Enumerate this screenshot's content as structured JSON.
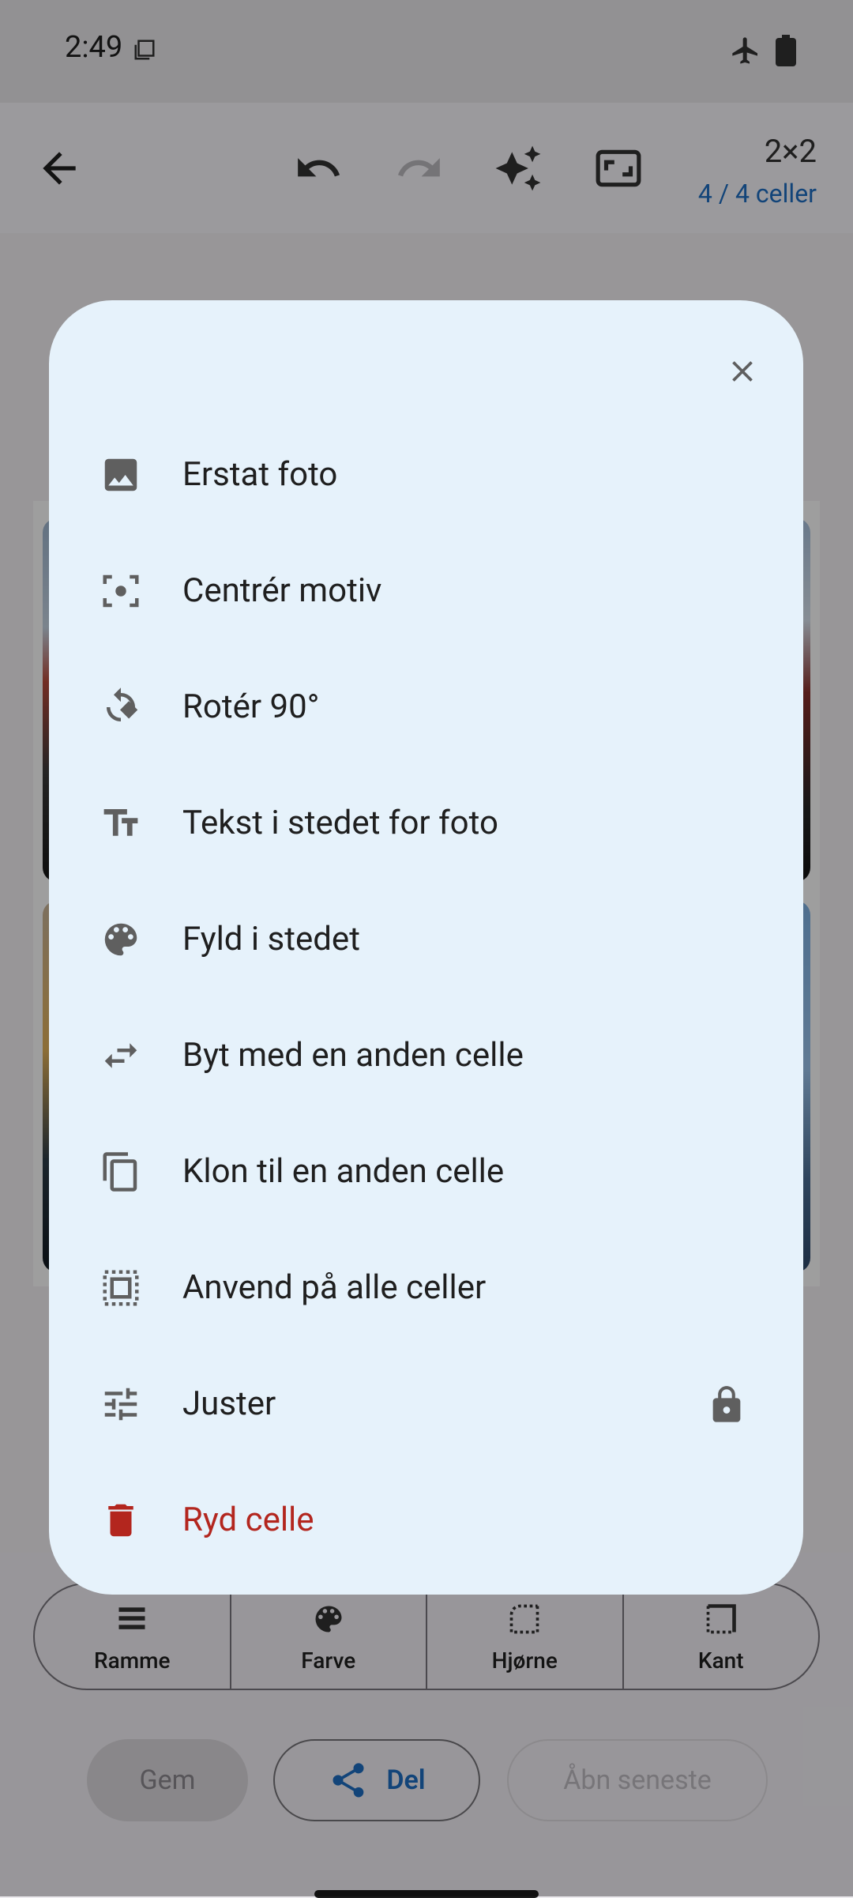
{
  "status_bar": {
    "time": "2:49"
  },
  "app_bar": {
    "grid_size": "2×2",
    "cell_count": "4 / 4 celler"
  },
  "toolbar": [
    {
      "label": "Ramme",
      "icon": "frame-icon"
    },
    {
      "label": "Farve",
      "icon": "palette-icon"
    },
    {
      "label": "Hjørne",
      "icon": "corner-icon"
    },
    {
      "label": "Kant",
      "icon": "border-icon"
    }
  ],
  "actions": {
    "save": "Gem",
    "share": "Del",
    "open_recent": "Åbn seneste"
  },
  "menu": {
    "items": [
      {
        "label": "Erstat foto",
        "icon": "image-icon"
      },
      {
        "label": "Centrér motiv",
        "icon": "center-focus-icon"
      },
      {
        "label": "Rotér 90°",
        "icon": "rotate-icon"
      },
      {
        "label": "Tekst i stedet for foto",
        "icon": "text-icon"
      },
      {
        "label": "Fyld i stedet",
        "icon": "palette-icon"
      },
      {
        "label": "Byt med en anden celle",
        "icon": "swap-icon"
      },
      {
        "label": "Klon til en anden celle",
        "icon": "copy-icon"
      },
      {
        "label": "Anvend på alle celler",
        "icon": "select-all-icon"
      },
      {
        "label": "Juster",
        "icon": "tune-icon",
        "locked": true
      },
      {
        "label": "Ryd celle",
        "icon": "delete-icon",
        "danger": true
      }
    ]
  },
  "colors": {
    "accent": "#1E6FC3",
    "danger": "#B3261E",
    "sheet": "#E6F2FB"
  }
}
